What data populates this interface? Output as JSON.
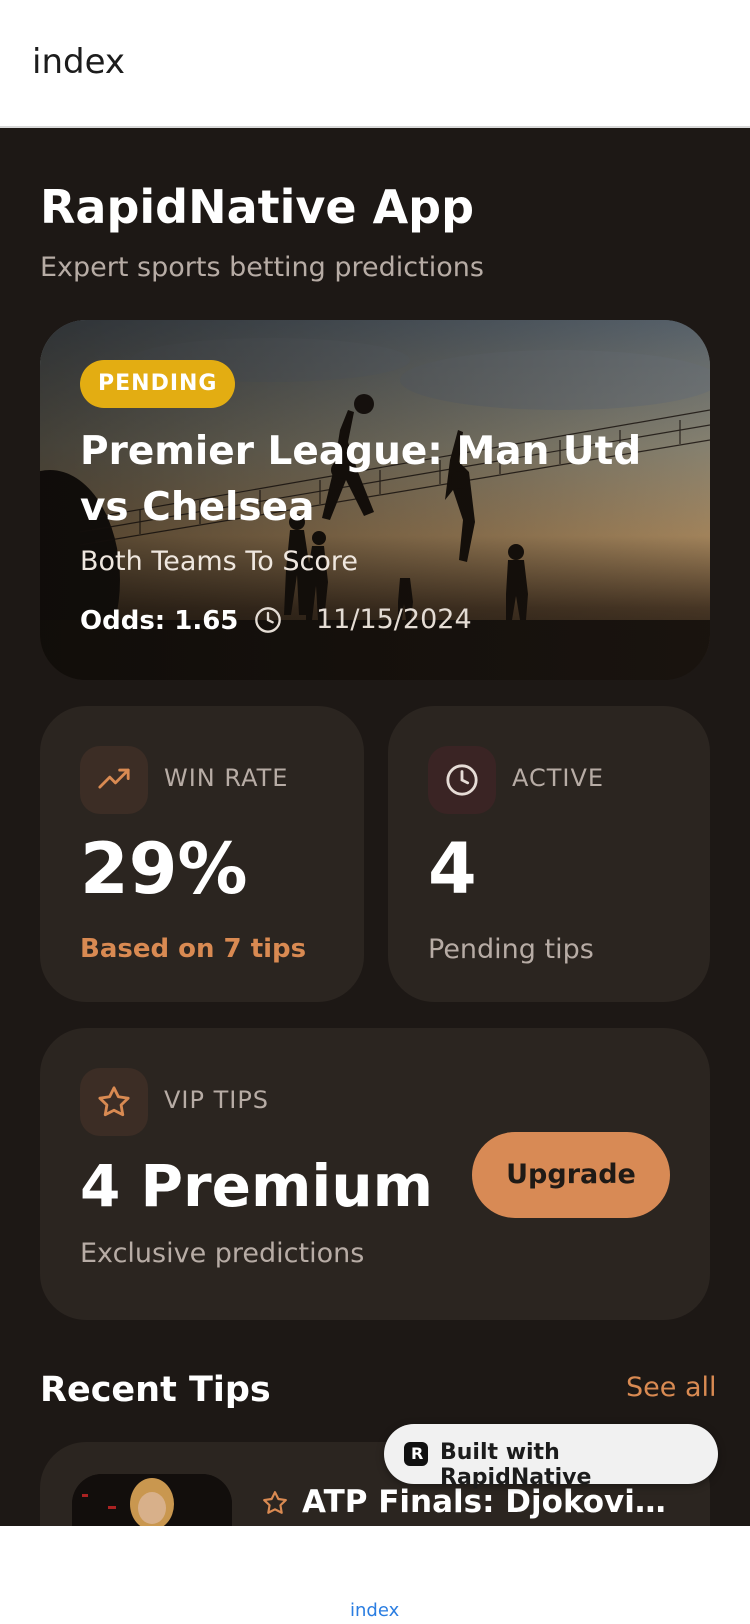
{
  "header": {
    "title": "index"
  },
  "app": {
    "title": "RapidNative App",
    "subtitle": "Expert sports betting predictions"
  },
  "featured": {
    "status": "PENDING",
    "match": "Premier League: Man Utd vs Chelsea",
    "market": "Both Teams To Score",
    "odds": "Odds: 1.65",
    "date": "11/15/2024",
    "icon": "clock-icon"
  },
  "stats": {
    "win_rate": {
      "label": "WIN RATE",
      "value": "29%",
      "note": "Based on 7 tips",
      "icon": "trending-up-icon"
    },
    "active": {
      "label": "ACTIVE",
      "value": "4",
      "note": "Pending tips",
      "icon": "clock-icon"
    },
    "vip": {
      "label": "VIP TIPS",
      "value": "4 Premium",
      "note": "Exclusive predictions",
      "button": "Upgrade",
      "icon": "star-icon"
    }
  },
  "recent": {
    "title": "Recent Tips",
    "see_all": "See all",
    "items": [
      {
        "title": "ATP Finals: Djokovic v...",
        "icon": "star-icon"
      }
    ]
  },
  "built_badge": {
    "text": "Built with RapidNative"
  },
  "tabbar": {
    "label": "index"
  },
  "colors": {
    "background": "#1d1815",
    "card": "#2b2520",
    "accent": "#d98a52",
    "badge": "#e3ad12"
  }
}
